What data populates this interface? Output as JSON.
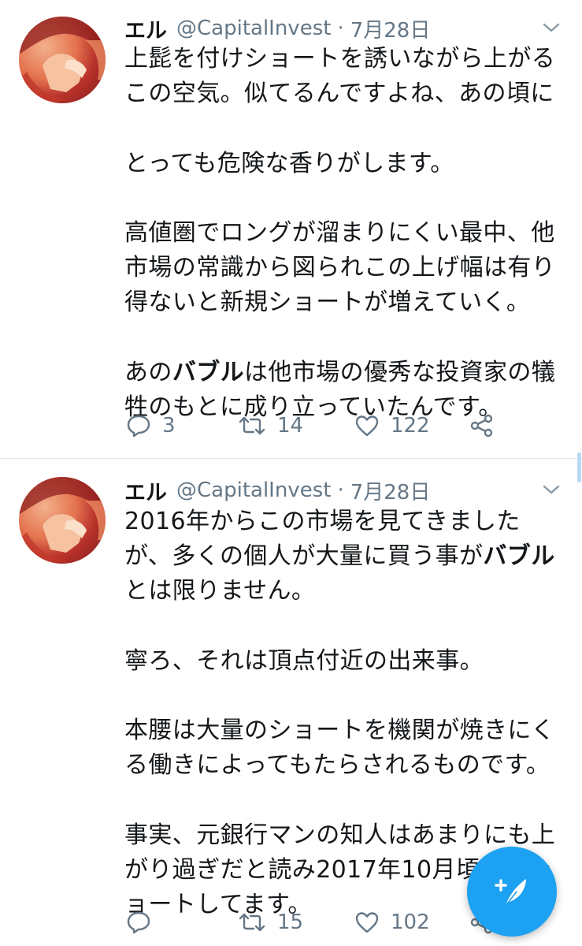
{
  "tweets": [
    {
      "name": "エル",
      "handle": "@CapitalInvest",
      "separator": "·",
      "date": "7月28日",
      "lines": [
        "上髭を付けショートを誘いながら上がる",
        "この空気。似てるんですよね、あの頃に",
        "",
        "とっても危険な香りがします。",
        "",
        "高値圏でロングが溜まりにくい最中、他",
        "市場の常識から図られこの上げ幅は有り",
        "得ないと新規ショートが増えていく。",
        "",
        "あのバブルは他市場の優秀な投資家の犠",
        "牲のもとに成り立っていたんです。"
      ],
      "bold_line6_pre": "あの",
      "bold_line6_word": "バブル",
      "bold_line6_post": "は他市場の優秀な投資家の犠",
      "reply_count": "3",
      "retweet_count": "14",
      "like_count": "122"
    },
    {
      "name": "エル",
      "handle": "@CapitalInvest",
      "separator": "·",
      "date": "7月28日",
      "line1": "2016年からこの市場を見てきました",
      "line2_pre": "が、多くの個人が大量に買う事が",
      "line2_word": "バブル",
      "lines": [
        "とは限りません。",
        "",
        "寧ろ、それは頂点付近の出来事。",
        "",
        "本腰は大量のショートを機関が焼きにく",
        "る働きによってもたらされるものです。",
        "",
        "事実、元銀行マンの知人はあまりにも上",
        "がり過ぎだと読み2017年10月頃数億シ",
        "ョートしてます。"
      ],
      "reply_count": "",
      "retweet_count": "15",
      "like_count": "102"
    }
  ],
  "icons": {
    "reply": "reply-icon",
    "retweet": "retweet-icon",
    "like": "heart-icon",
    "share": "share-icon",
    "caret": "chevron-down-icon",
    "compose": "compose-tweet-icon"
  },
  "colors": {
    "accent": "#1da1f2",
    "muted": "#657786",
    "text": "#14171a",
    "divider": "#e1e8ed"
  }
}
